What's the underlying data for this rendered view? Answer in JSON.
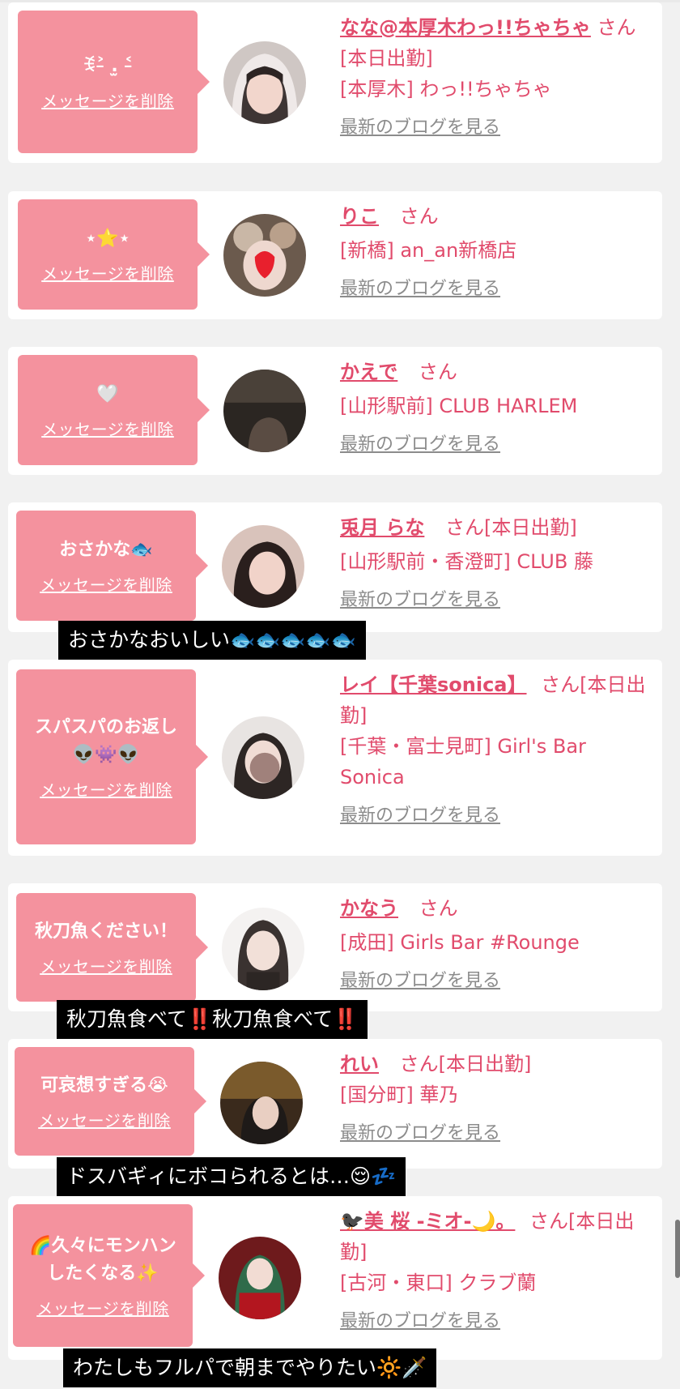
{
  "messages": [
    {
      "message": "ꉂ˃̵ .̫ ˂̵ ",
      "delete_label": "メッセージを削除",
      "name": "なな@本厚木わっ!!ちゃちゃ",
      "san_status": "さん[本日出勤]",
      "shop": "[本厚木] わっ!!ちゃちゃ",
      "blog_label": "最新のブログを見る"
    },
    {
      "message": "⋆⭐⋆",
      "delete_label": "メッセージを削除",
      "name": "りこ",
      "san_status": "さん",
      "shop": "[新橋] an_an新橋店",
      "blog_label": "最新のブログを見る"
    },
    {
      "message": "🤍",
      "delete_label": "メッセージを削除",
      "name": "かえで",
      "san_status": "さん",
      "shop": "[山形駅前] CLUB HARLEM",
      "blog_label": "最新のブログを見る"
    },
    {
      "message": "おさかな🐟",
      "delete_label": "メッセージを削除",
      "name": "兎月 らな",
      "san_status": "さん[本日出勤]",
      "shop": "[山形駅前・香澄町] CLUB 藤",
      "blog_label": "最新のブログを見る"
    },
    {
      "message": "スパスパのお返し\n👽👾👽",
      "delete_label": "メッセージを削除",
      "name": "レイ【千葉sonica】",
      "san_status": "さん[本日出勤]",
      "shop": "[千葉・富士見町] Girl's Bar Sonica",
      "blog_label": "最新のブログを見る"
    },
    {
      "message": "秋刀魚ください！",
      "delete_label": "メッセージを削除",
      "name": "かなう",
      "san_status": "さん",
      "shop": "[成田] Girls Bar #Rounge",
      "blog_label": "最新のブログを見る"
    },
    {
      "message": "可哀想すぎる😭",
      "delete_label": "メッセージを削除",
      "name": "れい",
      "san_status": "さん[本日出勤]",
      "shop": "[国分町] 華乃",
      "blog_label": "最新のブログを見る"
    },
    {
      "message": "🌈久々にモンハン\nしたくなる✨",
      "delete_label": "メッセージを削除",
      "name": "🐦‍⬛美 桜 -ミオ-🌙。",
      "san_status": "さん[本日出勤]",
      "shop": "[古河・東口] クラブ蘭",
      "blog_label": "最新のブログを見る"
    }
  ],
  "captions": [
    "おさかなおいしい🐟🐟🐟🐟🐟",
    "秋刀魚食べて‼️秋刀魚食べて‼️",
    "ドスバギィにボコられるとは…😌💤",
    "わたしもフルパで朝までやりたい🔆🗡️"
  ],
  "colors": {
    "accent_pink": "#f4929e",
    "name_pink": "#e14b6c",
    "link_gray": "#8c8c8c"
  }
}
